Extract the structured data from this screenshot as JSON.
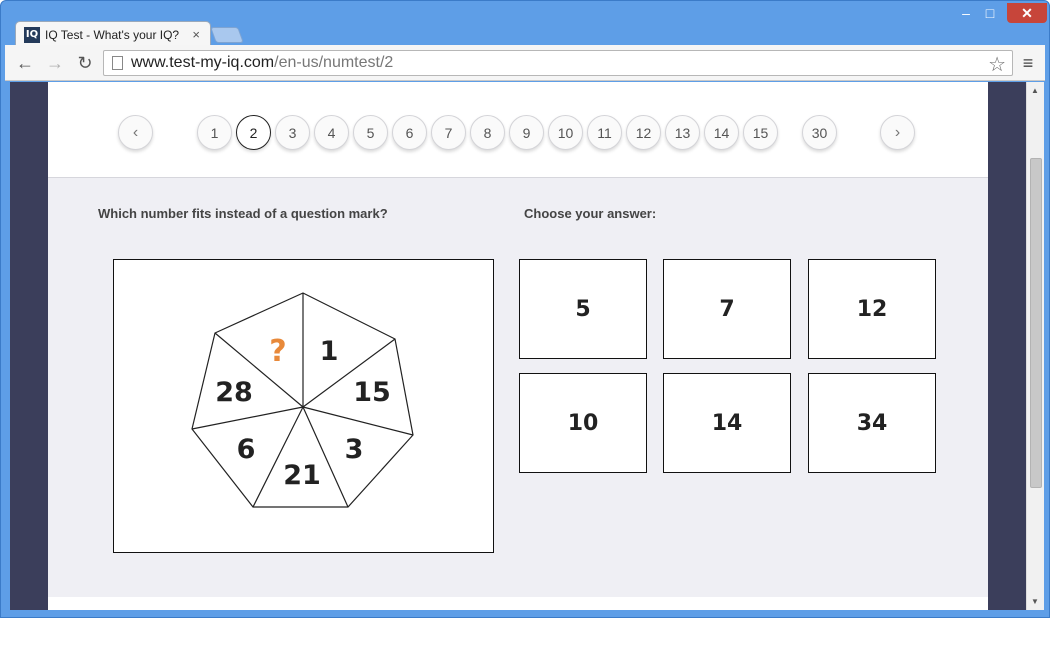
{
  "browser": {
    "tab_logo": "IQ",
    "tab_title": "IQ Test - What's your IQ?",
    "tab_close": "×",
    "url_host": "www.test-my-iq.com",
    "url_path": "/en-us/numtest/2",
    "minimize": "–",
    "maximize": "□",
    "close": "✕",
    "back_icon": "←",
    "forward_icon": "→",
    "reload_icon": "↻",
    "star_icon": "☆",
    "menu_icon": "≡"
  },
  "pagination": {
    "prev": "‹",
    "next": "›",
    "active": "2",
    "pages": [
      "1",
      "2",
      "3",
      "4",
      "5",
      "6",
      "7",
      "8",
      "9",
      "10",
      "11",
      "12",
      "13",
      "14",
      "15",
      "30"
    ]
  },
  "question": {
    "label": "Which number fits instead of a question mark?",
    "segments": [
      "?",
      "1",
      "15",
      "3",
      "21",
      "6",
      "28"
    ]
  },
  "answers": {
    "label": "Choose your answer:",
    "options": [
      "5",
      "7",
      "12",
      "10",
      "14",
      "34"
    ]
  },
  "colors": {
    "question_mark": "#e8893a",
    "page_bg": "#efeff4",
    "side_bg": "#3b3e5b"
  }
}
